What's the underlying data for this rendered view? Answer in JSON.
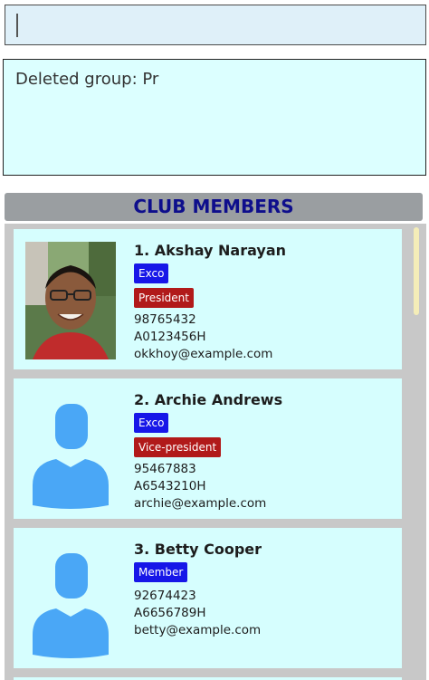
{
  "command": {
    "value": ""
  },
  "result": {
    "text": "Deleted group: Pr"
  },
  "members_header": {
    "title": "CLUB MEMBERS"
  },
  "members": [
    {
      "index_name": "1.  Akshay Narayan",
      "tags": [
        {
          "label": "Exco",
          "color": "#1717e8"
        },
        {
          "label": "President",
          "color": "#b11a1a"
        }
      ],
      "phone": "98765432",
      "matric": "A0123456H",
      "email": "okkhoy@example.com",
      "avatar": "photo"
    },
    {
      "index_name": "2.  Archie Andrews",
      "tags": [
        {
          "label": "Exco",
          "color": "#1717e8"
        },
        {
          "label": "Vice-president",
          "color": "#b11a1a"
        }
      ],
      "phone": "95467883",
      "matric": "A6543210H",
      "email": "archie@example.com",
      "avatar": "default-person-icon"
    },
    {
      "index_name": "3.  Betty Cooper",
      "tags": [
        {
          "label": "Member",
          "color": "#1717e8"
        }
      ],
      "phone": "92674423",
      "matric": "A6656789H",
      "email": "betty@example.com",
      "avatar": "default-person-icon"
    }
  ],
  "colors": {
    "header_text": "#0e0e8c",
    "card_bg": "#d6fefe",
    "tag_blue": "#1717e8",
    "tag_red": "#b11a1a"
  }
}
